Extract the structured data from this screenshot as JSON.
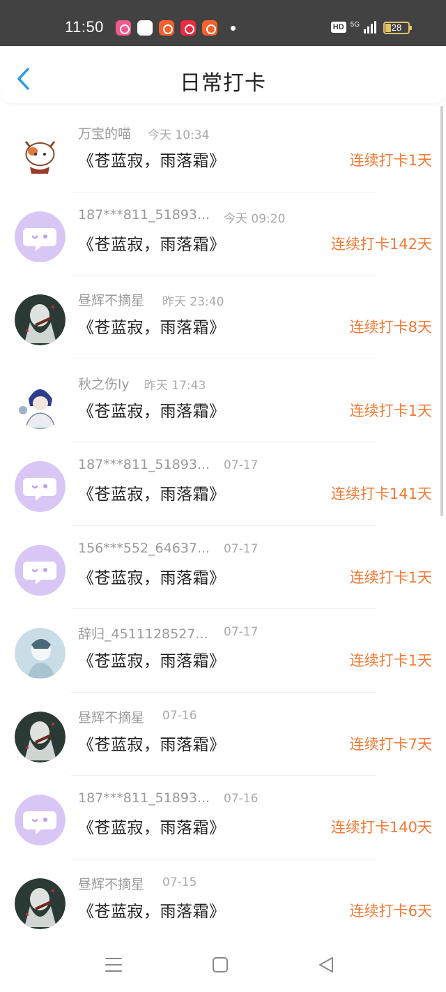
{
  "status_bar": {
    "time": "11:50",
    "hd": "HD",
    "network": "5G",
    "battery": "28"
  },
  "header": {
    "title": "日常打卡"
  },
  "entries": [
    {
      "name": "万宝的喵",
      "time": "今天 10:34",
      "book": "《苍蓝寂，雨落霜》",
      "streak": "连续打卡1天",
      "avatar": "cat-avatar"
    },
    {
      "name": "187***811_51893...",
      "time": "今天 09:20",
      "book": "《苍蓝寂，雨落霜》",
      "streak": "连续打卡142天",
      "avatar": "default-avatar"
    },
    {
      "name": "昼辉不摘星",
      "time": "昨天 23:40",
      "book": "《苍蓝寂，雨落霜》",
      "streak": "连续打卡8天",
      "avatar": "violin-avatar"
    },
    {
      "name": "秋之伤ly",
      "time": "昨天 17:43",
      "book": "《苍蓝寂，雨落霜》",
      "streak": "连续打卡1天",
      "avatar": "boy-avatar"
    },
    {
      "name": "187***811_51893...",
      "time": "07-17",
      "book": "《苍蓝寂，雨落霜》",
      "streak": "连续打卡141天",
      "avatar": "default-avatar"
    },
    {
      "name": "156***552_64637...",
      "time": "07-17",
      "book": "《苍蓝寂，雨落霜》",
      "streak": "连续打卡1天",
      "avatar": "default-avatar"
    },
    {
      "name": "辞归_4511128527...",
      "time": "07-17",
      "book": "《苍蓝寂，雨落霜》",
      "streak": "连续打卡1天",
      "avatar": "blue-avatar"
    },
    {
      "name": "昼辉不摘星",
      "time": "07-16",
      "book": "《苍蓝寂，雨落霜》",
      "streak": "连续打卡7天",
      "avatar": "violin-avatar"
    },
    {
      "name": "187***811_51893...",
      "time": "07-16",
      "book": "《苍蓝寂，雨落霜》",
      "streak": "连续打卡140天",
      "avatar": "default-avatar"
    },
    {
      "name": "昼辉不摘星",
      "time": "07-15",
      "book": "《苍蓝寂，雨落霜》",
      "streak": "连续打卡6天",
      "avatar": "violin-avatar"
    }
  ],
  "colors": {
    "streak": "#f07a37",
    "back_arrow": "#2a9be8",
    "default_avatar_bg": "#d8c6f5"
  },
  "nav": {
    "menu_icon": "menu-icon",
    "home_icon": "square-home-icon",
    "back_icon": "triangle-back-icon"
  }
}
